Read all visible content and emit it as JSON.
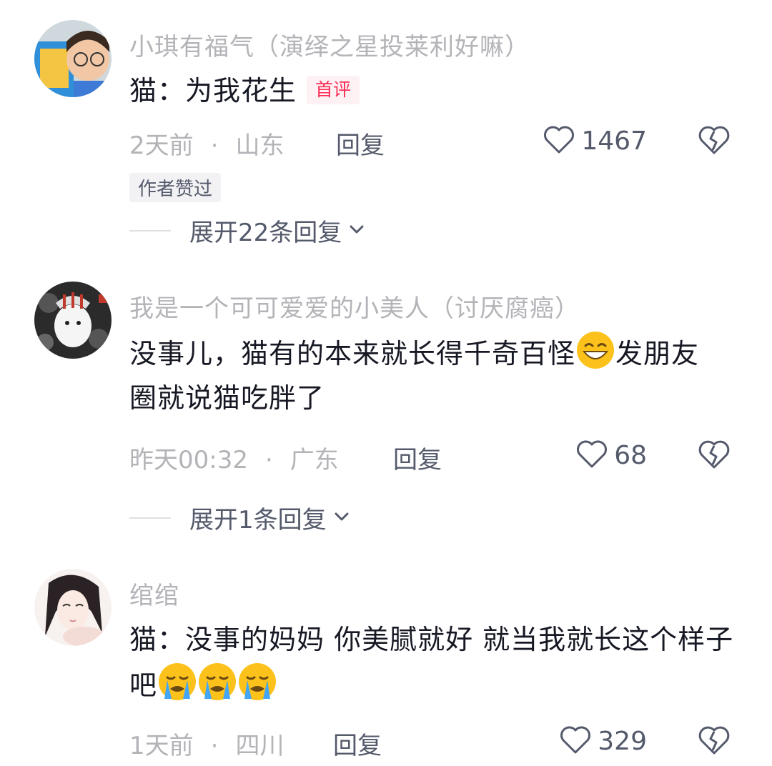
{
  "comments": [
    {
      "username": "小琪有福气（演绎之星投莱利好嘛）",
      "text": "猫：为我花生",
      "badge": "首评",
      "time": "2天前",
      "dot": "·",
      "location": "山东",
      "reply_label": "回复",
      "likes": "1467",
      "author_tag": "作者赞过",
      "expand_label": "展开22条回复"
    },
    {
      "username": "我是一个可可爱爱的小美人（讨厌腐癌）",
      "text_part1": "没事儿，猫有的本来就长得千奇百怪",
      "emoji1": "grinning-sweat-emoji",
      "text_part2": "发朋友圈就说猫吃胖了",
      "time": "昨天00:32",
      "dot": "·",
      "location": "广东",
      "reply_label": "回复",
      "likes": "68",
      "expand_label": "展开1条回复"
    },
    {
      "username": "绾绾",
      "text": "猫：没事的妈妈 你美腻就好 就当我就长这个样子吧",
      "emoji": "crying-face-emoji",
      "emoji_count": 3,
      "time": "1天前",
      "dot": "·",
      "location": "四川",
      "reply_label": "回复",
      "likes": "329"
    }
  ],
  "colors": {
    "primary_text": "#161823",
    "secondary_text": "#b3b3b8",
    "action_text": "#545a6b",
    "badge_red": "#fe2c55"
  }
}
